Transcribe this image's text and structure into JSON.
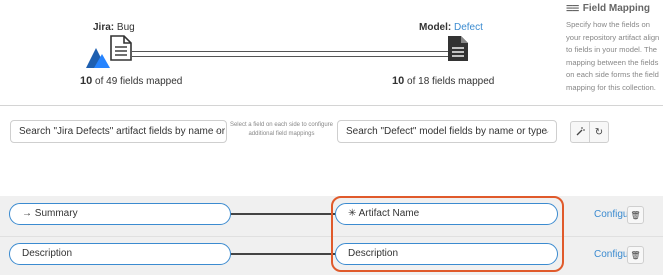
{
  "header": {
    "jira_label": "Jira:",
    "jira_type": "Bug",
    "model_label": "Model:",
    "model_name": "Defect",
    "left_mapped_count": "10",
    "left_mapped_text": "of 49 fields mapped",
    "right_mapped_count": "10",
    "right_mapped_text": "of 18 fields mapped"
  },
  "info_panel": {
    "title": "Field Mapping",
    "description": "Specify how the fields on your repository artifact align to fields in your model. The mapping between the fields on each side forms the field mapping for this collection."
  },
  "search": {
    "left_text": "Search \"Jira Defects\" artifact fields by name or…",
    "hint": "Select a field on each side to configure additional field mappings",
    "right_text": "Search \"Defect\" model fields by name or type"
  },
  "mappings": [
    {
      "left_prefix": "→",
      "left": "Summary",
      "right_prefix": "✳",
      "right": "Artifact Name",
      "configure_label": "Configure"
    },
    {
      "left_prefix": "",
      "left": "Description",
      "right_prefix": "",
      "right": "Description",
      "configure_label": "Configure"
    }
  ],
  "colors": {
    "accent": "#3b8bd0",
    "highlight": "#e05a2b",
    "jira_blue": "#2684ff"
  },
  "icons": {
    "jira": "jira-logo-icon",
    "document": "document-icon",
    "field_mapping": "lines-icon",
    "auto_map": "wand-icon",
    "reset": "refresh-icon",
    "delete": "trash-icon"
  }
}
